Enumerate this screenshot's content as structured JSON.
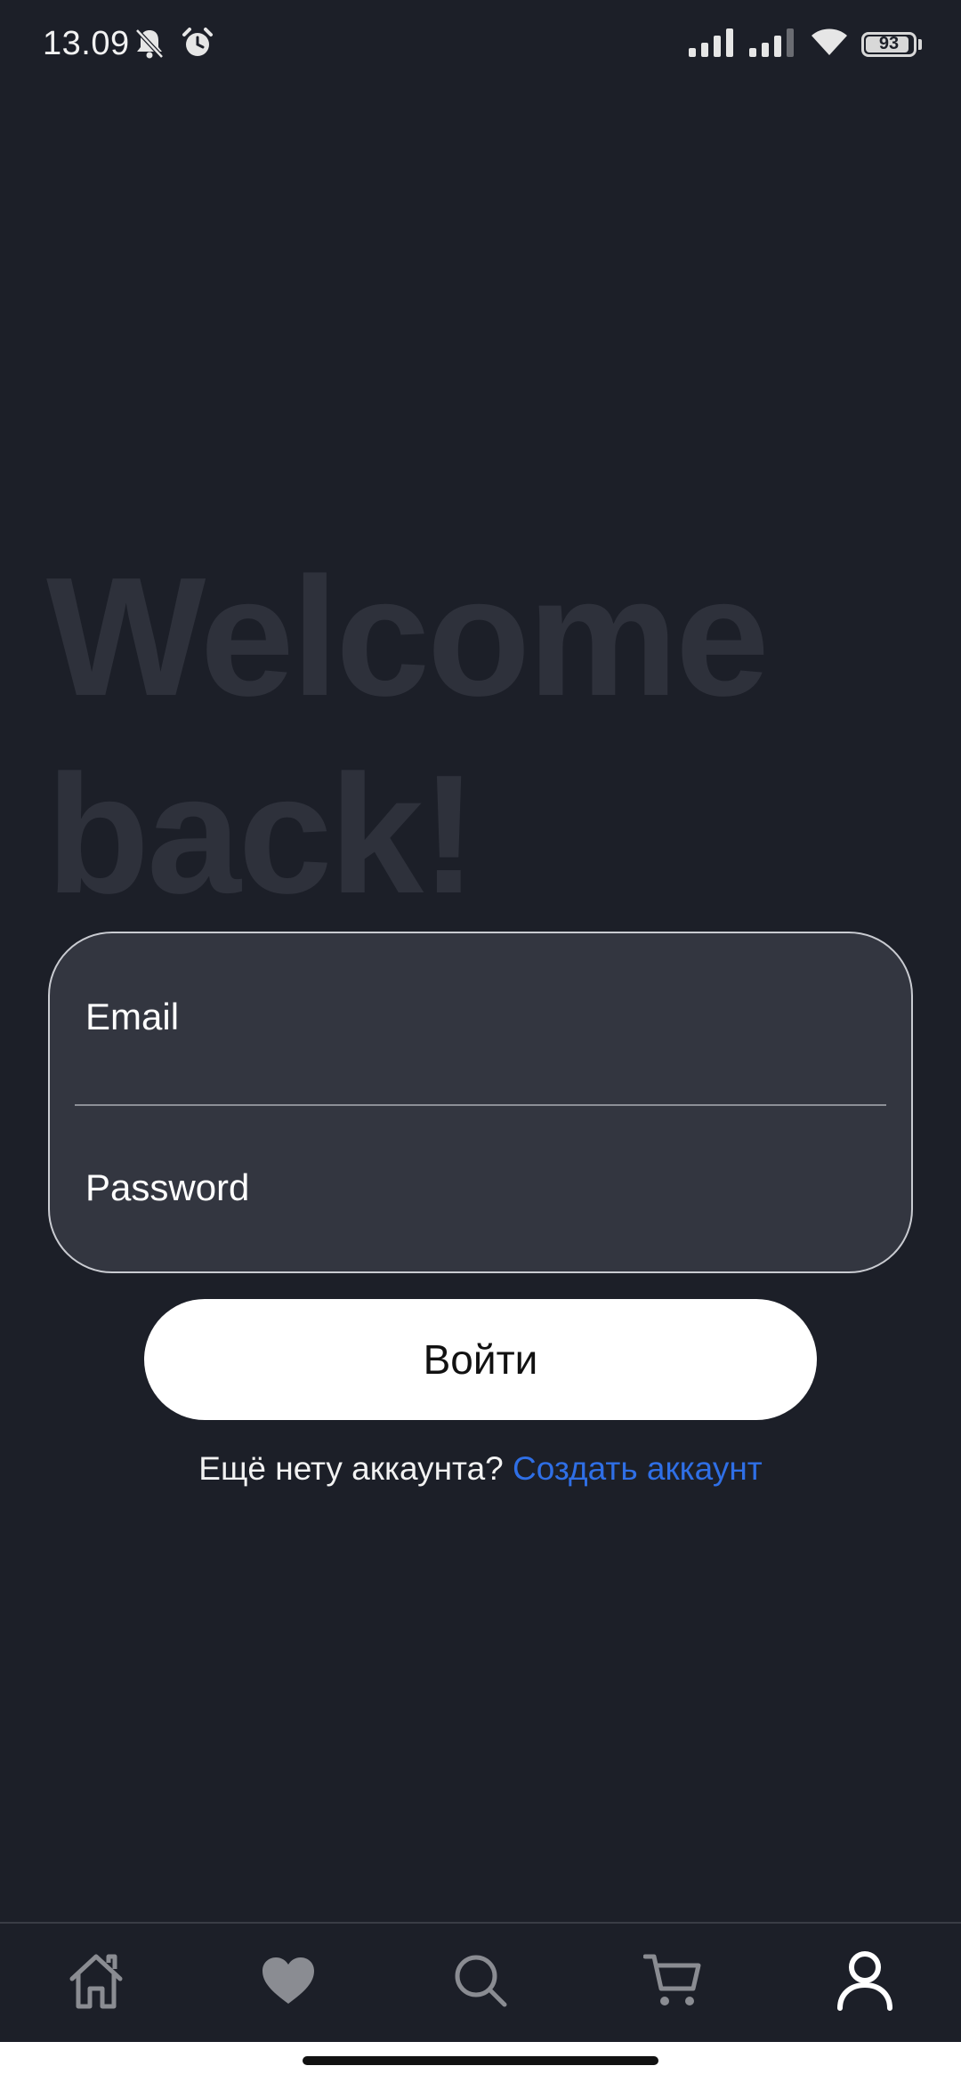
{
  "status_bar": {
    "time": "13.09",
    "battery_level": "93",
    "battery_fraction": 0.93,
    "icons": [
      "bell-off-icon",
      "alarm-icon",
      "signal-icon",
      "signal-icon",
      "wifi-icon",
      "battery-icon"
    ]
  },
  "welcome": {
    "line1": "Welcome",
    "line2": "back!"
  },
  "login_form": {
    "email_placeholder": "Email",
    "password_placeholder": "Password"
  },
  "login_button": {
    "label": "Войти"
  },
  "register": {
    "prompt": "Ещё нету аккаунта?",
    "link": "Создать аккаунт"
  },
  "bottom_nav": {
    "items": [
      {
        "icon": "home-icon",
        "active": false
      },
      {
        "icon": "heart-icon",
        "active": false
      },
      {
        "icon": "search-icon",
        "active": false
      },
      {
        "icon": "cart-icon",
        "active": false
      },
      {
        "icon": "profile-icon",
        "active": true
      }
    ]
  },
  "colors": {
    "background": "#1c1f28",
    "card": "#333640",
    "accent_link": "#2f6fe6",
    "heading_muted": "#2e313b",
    "nav_inactive": "#8a8c92",
    "nav_active": "#ffffff"
  }
}
